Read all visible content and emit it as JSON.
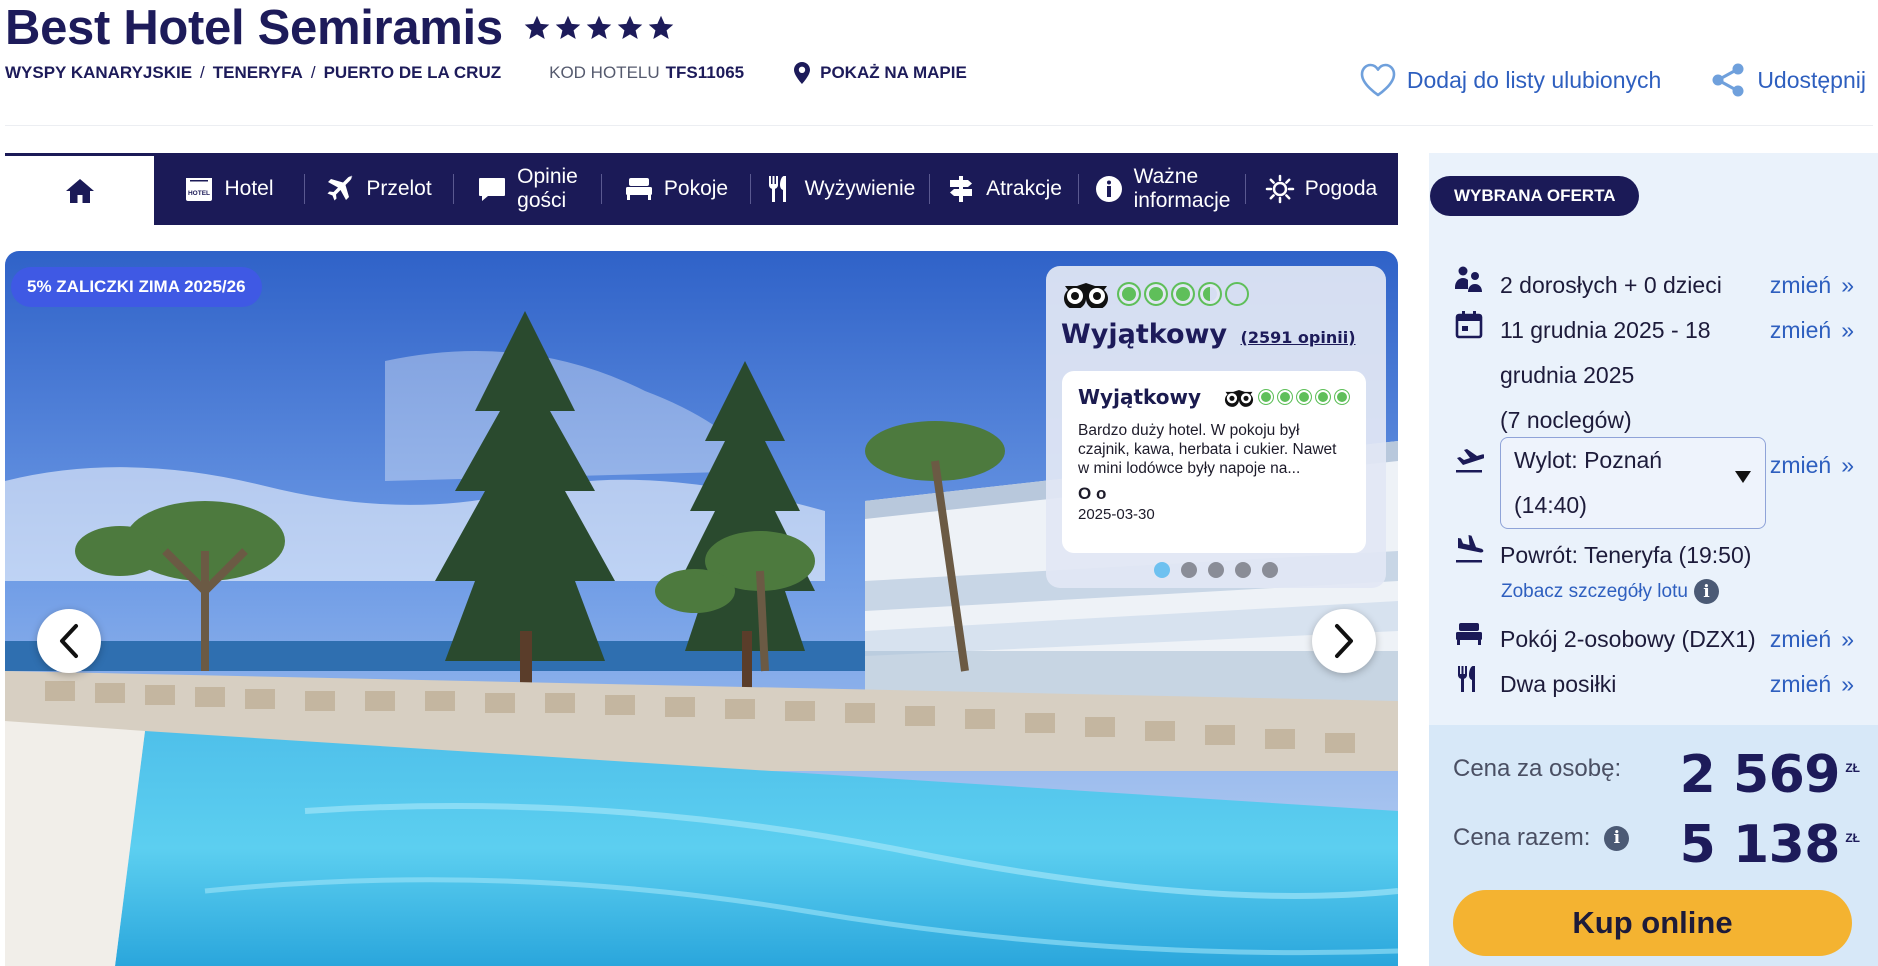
{
  "hotel": {
    "name": "Best Hotel Semiramis",
    "stars": 5,
    "breadcrumb": [
      "WYSPY KANARYJSKIE",
      "TENERYFA",
      "PUERTO DE LA CRUZ"
    ],
    "breadcrumb_sep": "/",
    "code_label": "KOD HOTELU",
    "code": "TFS11065",
    "map_link": "POKAŻ NA MAPIE"
  },
  "actions": {
    "favorite": "Dodaj do listy ulubionych",
    "share": "Udostępnij"
  },
  "nav": {
    "home_icon": "home-icon",
    "items": [
      {
        "label": "Hotel",
        "icon": "hotel-icon"
      },
      {
        "label": "Przelot",
        "icon": "plane-icon"
      },
      {
        "label": "Opinie gości",
        "label_line1": "Opinie",
        "label_line2": "gości",
        "icon": "comment-icon"
      },
      {
        "label": "Pokoje",
        "icon": "bed-icon"
      },
      {
        "label": "Wyżywienie",
        "icon": "cutlery-icon"
      },
      {
        "label": "Atrakcje",
        "icon": "signpost-icon"
      },
      {
        "label": "Ważne informacje",
        "label_line1": "Ważne",
        "label_line2": "informacje",
        "icon": "info-icon"
      },
      {
        "label": "Pogoda",
        "icon": "sun-icon"
      }
    ]
  },
  "gallery": {
    "promo": "5% ZALICZKI ZIMA 2025/26",
    "rating": {
      "bubbles": 3.5,
      "label": "Wyjątkowy",
      "reviews_link": "(2591 opinii)"
    },
    "review": {
      "title": "Wyjątkowy",
      "bubbles": 5,
      "text": "Bardzo duży hotel. W pokoju był czajnik, kawa, herbata i cukier. Nawet w mini lodówce były napoje na...",
      "author": "O o",
      "date": "2025-03-30"
    },
    "dots": 5,
    "active_dot": 0
  },
  "offer": {
    "badge": "WYBRANA OFERTA",
    "change_label": "zmień",
    "change_arrow": "»",
    "guests": "2 dorosłych + 0 dzieci",
    "dates_line1": "11 grudnia 2025 - 18",
    "dates_line2": "grudnia 2025",
    "nights": "(7 noclegów)",
    "departure_line1": "Wylot: Poznań",
    "departure_line2": "(14:40)",
    "return": "Powrót: Teneryfa (19:50)",
    "flight_details": "Zobacz szczegóły lotu",
    "room": "Pokój 2-osobowy (DZX1)",
    "board": "Dwa posiłki",
    "price_per_person_label": "Cena za osobę:",
    "price_per_person": "2 569",
    "price_total_label": "Cena razem:",
    "price_total": "5 138",
    "currency": "ZŁ",
    "buy": "Kup online"
  },
  "colors": {
    "navy": "#1b1a57",
    "accent_blue": "#2e5fbf",
    "promo_blue": "#3f59e4",
    "ta_green": "#5fbf5a",
    "buy_yellow": "#f4b331",
    "panel_bg": "#eaf2fb",
    "price_bg": "#d7e8f8"
  }
}
